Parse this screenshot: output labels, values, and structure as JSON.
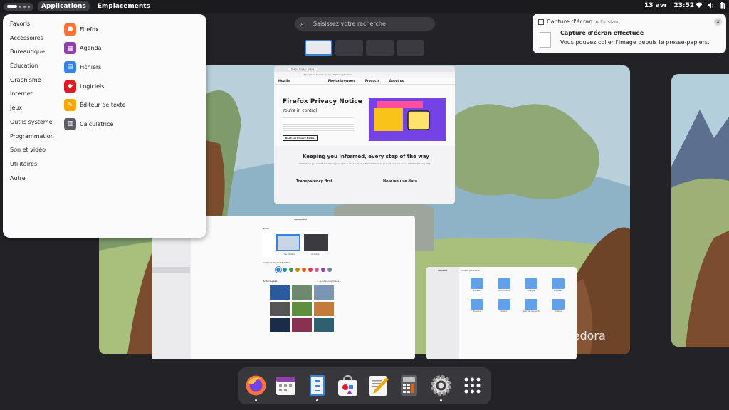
{
  "topbar": {
    "applications_label": "Applications",
    "places_label": "Emplacements",
    "date": "13 avr",
    "time": "23:52",
    "tray_icons": [
      "network-wireless-icon",
      "audio-volume-icon",
      "battery-icon"
    ]
  },
  "search": {
    "placeholder": "Saisissez votre recherche"
  },
  "apps_menu": {
    "categories": [
      "Favoris",
      "Accessoires",
      "Bureautique",
      "Éducation",
      "Graphisme",
      "Internet",
      "Jeux",
      "Outils système",
      "Programmation",
      "Son et vidéo",
      "Utilitaires",
      "Autre"
    ],
    "apps": [
      {
        "label": "Firefox",
        "icon": "firefox-icon",
        "color": "#ff7139"
      },
      {
        "label": "Agenda",
        "icon": "calendar-icon",
        "color": "#9141ac"
      },
      {
        "label": "Fichiers",
        "icon": "files-icon",
        "color": "#3584e4"
      },
      {
        "label": "Logiciels",
        "icon": "software-icon",
        "color": "#e01b24"
      },
      {
        "label": "Éditeur de texte",
        "icon": "text-editor-icon",
        "color": "#f6a600"
      },
      {
        "label": "Calculatrice",
        "icon": "calculator-icon",
        "color": "#5e5c64"
      }
    ]
  },
  "notification": {
    "app_name": "Capture d'écran",
    "time": "À l'instant",
    "title": "Capture d'écran effectuée",
    "body": "Vous pouvez coller l'image depuis le presse-papiers.",
    "close_glyph": "✕"
  },
  "firefox_window": {
    "tab_label": "Firefox Privacy Notice",
    "url": "https://www.mozilla.org/en-US/privacy/firefox/",
    "site_brand": "Mozilla",
    "nav_items": [
      "Firefox browsers",
      "Products",
      "About us"
    ],
    "heading": "Firefox Privacy Notice",
    "subheading": "You're in control",
    "cta": "Read our Privacy Notice",
    "section_title": "Keeping you informed, every step of the way",
    "section_text": "We believe you should know how your data is used and why. Firefox is built to protect your privacy in small and every step.",
    "col1_title": "Transparency first",
    "col2_title": "How we use data"
  },
  "settings_window": {
    "title": "Apparence",
    "style_label": "Style",
    "style_options": [
      "Par défaut",
      "Sombre"
    ],
    "accent_label": "Couleur d'accentuation",
    "accent_colors": [
      "#3584e4",
      "#2190a4",
      "#3a944a",
      "#c88800",
      "#ed5b00",
      "#e62d42",
      "#d56199",
      "#9141ac",
      "#6f8396"
    ],
    "background_label": "Arrière-plan",
    "add_image_label": "+ Ajouter une image..."
  },
  "files_window": {
    "sidebar_title": "Fichiers",
    "path": "Dossier personnel",
    "folders": [
      "Bureau",
      "Documents",
      "Images",
      "Modèles",
      "Musique",
      "Public",
      "Téléchargements",
      "Vidéos"
    ],
    "wallpaper_brand": "fedora"
  },
  "dock": {
    "items": [
      {
        "name": "firefox",
        "running": true
      },
      {
        "name": "calendar",
        "running": false
      },
      {
        "name": "files",
        "running": true
      },
      {
        "name": "software",
        "running": false
      },
      {
        "name": "text-editor",
        "running": false
      },
      {
        "name": "calculator",
        "running": false
      },
      {
        "name": "settings",
        "running": true
      },
      {
        "name": "app-grid",
        "running": false
      }
    ]
  }
}
